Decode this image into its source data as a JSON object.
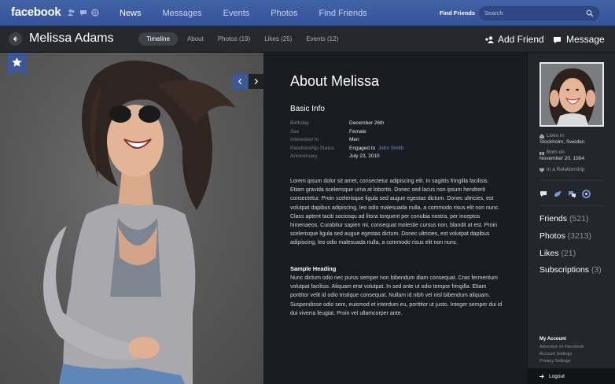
{
  "topbar": {
    "logo": "facebook",
    "nav": [
      "News",
      "Messages",
      "Events",
      "Photos",
      "Find Friends"
    ],
    "find_friends": "Find Friends",
    "search_placeholder": "Search"
  },
  "profile": {
    "name": "Melissa Adams",
    "tabs": [
      "Timeline",
      "About",
      "Photos (19)",
      "Likes (25)",
      "Events (12)"
    ],
    "add_friend": "Add Friend",
    "message": "Message"
  },
  "about": {
    "title": "About Melissa",
    "basic_info": "Basic Info",
    "rows": [
      {
        "label": "Birthday",
        "value": "December 26th"
      },
      {
        "label": "Sex",
        "value": "Female"
      },
      {
        "label": "Interested In",
        "value": "Men"
      },
      {
        "label": "Relationship Status",
        "value": "Engaged to ",
        "link": "John Smith"
      },
      {
        "label": "Anniversary",
        "value": "July 23, 2010"
      }
    ],
    "bio": "Lorem ipsum dolor sit amet, consectetur adipiscing elit. In sagittis fringilla facilisis. Etiam gravida scelerisque urna at lobortis. Donec sed lacus non ipsum hendrerit consectetur. Proin scelerisque ligula sed augue egestas dictum. Donec ultricies, est volutpat dapibus adipiscing, leo odio malesuada nulla, a commodo risus elit non nunc. Class aptent taciti sociosqu ad litora torquent per conubia nostra, per inceptos himenaeos. Curabitur sapien mi, consequat molestie cursus non, blandit at est. Proin scelerisque ligula sed augue egestas dictum. Donec ultricies, est volutpat dapibus adipiscing, leo odio malesuada nulla, a commodo risus elit non nunc.",
    "sample_heading": "Sample Heading",
    "bio2": "Nunc dictum odio nec purus semper non bibendum diam consequat. Cras fermentum volutpat facilisis. Aliquam erat volutpat. In sed ante ut odio tempor fringilla. Etiam porttitor velit id odio tristique consequat. Nullam id nibh vel nisl bibendum aliquam. Suspendisse odio sem, euismod et interdum eu, porttitor ut justo. Integer semper dui id dui viverra feugiat. Proin vel ullamcorper ante."
  },
  "sidebar": {
    "lives_label": "Lives in",
    "lives_value": "Stockholm, Sweden",
    "born_label": "Born on",
    "born_value": "November 20, 1984",
    "relationship": "In a Relationship",
    "stats": [
      {
        "label": "Friends",
        "count": "(521)"
      },
      {
        "label": "Photos",
        "count": "(3213)"
      },
      {
        "label": "Likes",
        "count": "(21)"
      },
      {
        "label": "Subscriptions",
        "count": "(3)"
      }
    ],
    "my_account": "My Account",
    "account_links": [
      "Advertise on Facebook",
      "Account Settings",
      "Privacy Settings"
    ],
    "logout": "Logout"
  },
  "icons": {
    "star_badge": "star-icon",
    "accent": "#3b5998"
  }
}
